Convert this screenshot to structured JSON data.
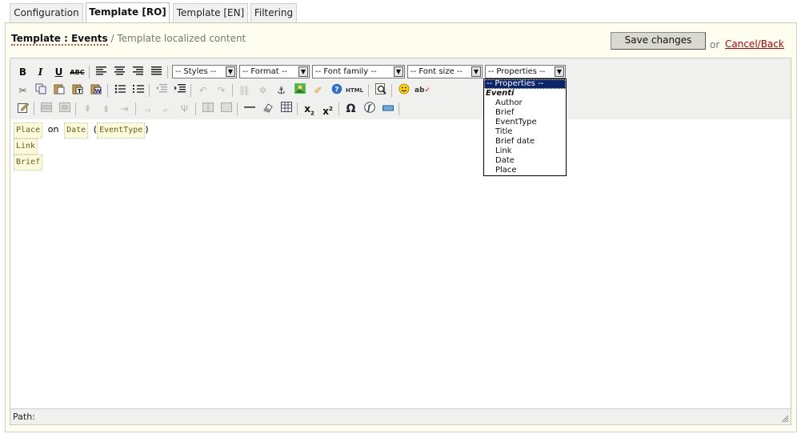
{
  "tabs": [
    {
      "label": "Configuration"
    },
    {
      "label": "Template [RO]"
    },
    {
      "label": "Template [EN]"
    },
    {
      "label": "Filtering"
    }
  ],
  "header": {
    "title": "Template : Events",
    "subtitle": "/ Template localized content",
    "save_label": "Save changes",
    "or_text": "or",
    "cancel_label": "Cancel/Back"
  },
  "toolbar": {
    "styles": "-- Styles --",
    "format": "-- Format --",
    "font_family": "-- Font family --",
    "font_size": "-- Font size --",
    "properties": "-- Properties --"
  },
  "content": {
    "place": "Place",
    "on": "on",
    "date": "Date",
    "open_paren": "(",
    "event_type": "EventType",
    "close_paren": ")",
    "link": "Link",
    "brief": "Brief"
  },
  "status": {
    "path_label": "Path:"
  },
  "properties_dropdown": {
    "selected": "-- Properties --",
    "group": "Eventi",
    "items": [
      "Author",
      "Brief",
      "EventType",
      "Title",
      "Brief date",
      "Link",
      "Date",
      "Place"
    ]
  }
}
